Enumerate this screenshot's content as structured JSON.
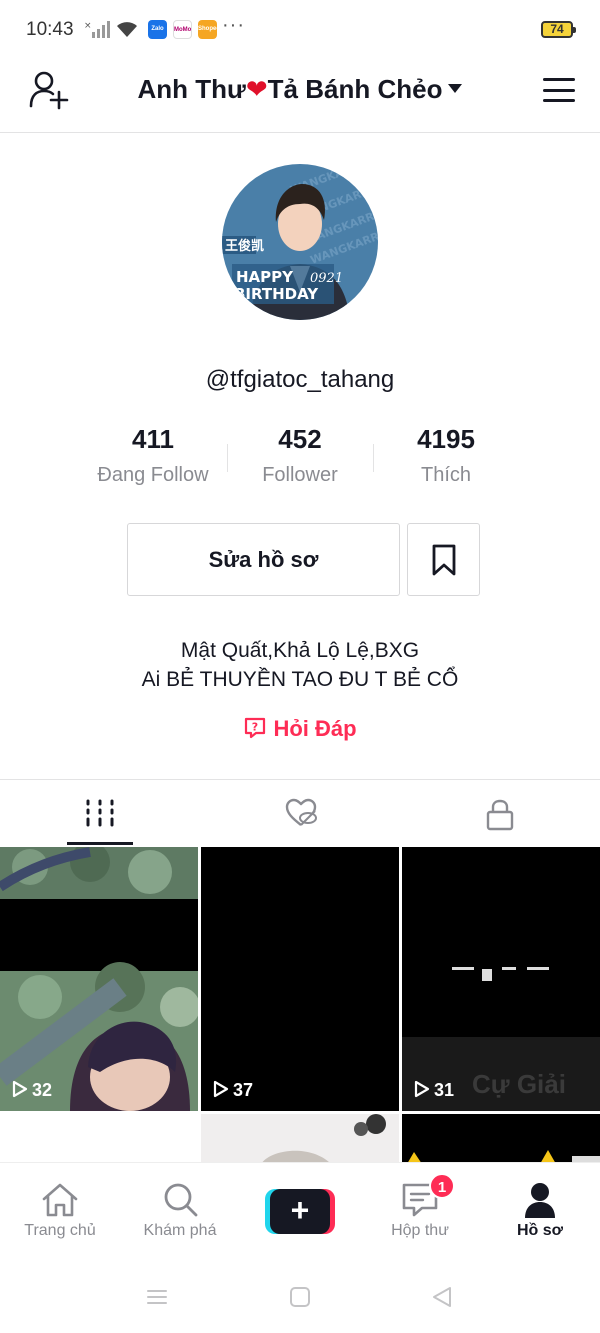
{
  "status_bar": {
    "time": "10:43",
    "apps": [
      "Zalo",
      "MoMo",
      "Shopee"
    ],
    "more": "···",
    "battery": "74"
  },
  "header": {
    "title_part1": "Anh Thư",
    "title_heart": "❤",
    "title_part2": "Tả Bánh Chẻo"
  },
  "profile": {
    "avatar_text": {
      "name": "王俊凯",
      "line1": "HAPPY",
      "line2": "BIRTHDAY",
      "date": "0921"
    },
    "username": "@tfgiatoc_tahang",
    "stats": [
      {
        "value": "411",
        "label": "Đang Follow"
      },
      {
        "value": "452",
        "label": "Follower"
      },
      {
        "value": "4195",
        "label": "Thích"
      }
    ],
    "edit_button": "Sửa hồ sơ",
    "bio_line1": "Mật Quất,Khả Lộ Lệ,BXG",
    "bio_line2": "Ai BẺ THUYỀN TAO ĐU T BẺ CỔ",
    "qa_label": "Hỏi Đáp"
  },
  "videos": [
    {
      "views": "32"
    },
    {
      "views": "37"
    },
    {
      "views": "31",
      "overlay_text": "Cự Giải"
    }
  ],
  "bottom_nav": {
    "items": [
      {
        "label": "Trang chủ",
        "icon": "home-icon"
      },
      {
        "label": "Khám phá",
        "icon": "search-icon"
      },
      {
        "label": "",
        "icon": "plus-icon"
      },
      {
        "label": "Hộp thư",
        "icon": "inbox-icon",
        "badge": "1"
      },
      {
        "label": "Hồ sơ",
        "icon": "profile-icon"
      }
    ]
  },
  "colors": {
    "accent": "#fe2c55",
    "text": "#161823",
    "muted": "#8a8b91",
    "cyan": "#20d5ec"
  }
}
